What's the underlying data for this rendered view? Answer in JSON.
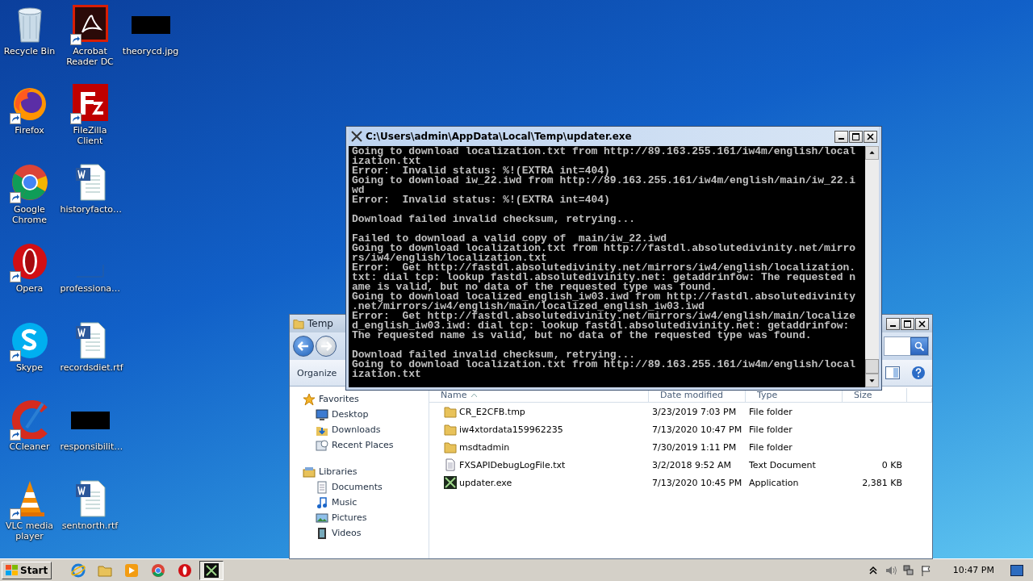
{
  "desktop": {
    "icons": [
      {
        "label": "Recycle Bin",
        "kind": "bin",
        "shortcut": false
      },
      {
        "label": "Firefox",
        "kind": "firefox",
        "shortcut": true
      },
      {
        "label": "Google Chrome",
        "kind": "chrome",
        "shortcut": true
      },
      {
        "label": "Opera",
        "kind": "opera",
        "shortcut": true
      },
      {
        "label": "Skype",
        "kind": "skype",
        "shortcut": true
      },
      {
        "label": "CCleaner",
        "kind": "ccleaner",
        "shortcut": true
      },
      {
        "label": "VLC media player",
        "kind": "vlc",
        "shortcut": true
      },
      {
        "label": "Acrobat Reader DC",
        "kind": "acrobat",
        "shortcut": true
      },
      {
        "label": "FileZilla Client",
        "kind": "filezilla",
        "shortcut": true
      },
      {
        "label": "historyfacto…",
        "kind": "word",
        "shortcut": false
      },
      {
        "label": "professiona…",
        "kind": "blank",
        "shortcut": false
      },
      {
        "label": "recordsdiet.rtf",
        "kind": "word",
        "shortcut": false
      },
      {
        "label": "responsibilit…",
        "kind": "image",
        "shortcut": false
      },
      {
        "label": "sentnorth.rtf",
        "kind": "word",
        "shortcut": false
      },
      {
        "label": "theorycd.jpg",
        "kind": "image",
        "shortcut": false
      }
    ]
  },
  "explorer": {
    "title": "Temp",
    "organize": "Organize",
    "nav": [
      {
        "label": "Favorites",
        "kind": "star",
        "children": [
          {
            "label": "Desktop",
            "kind": "desktop"
          },
          {
            "label": "Downloads",
            "kind": "downloads"
          },
          {
            "label": "Recent Places",
            "kind": "recent"
          }
        ]
      },
      {
        "label": "Libraries",
        "kind": "library",
        "children": [
          {
            "label": "Documents",
            "kind": "documents"
          },
          {
            "label": "Music",
            "kind": "music"
          },
          {
            "label": "Pictures",
            "kind": "pictures"
          },
          {
            "label": "Videos",
            "kind": "videos"
          }
        ]
      }
    ],
    "columns": [
      {
        "label": "Name",
        "sorted": true
      },
      {
        "label": "Date modified",
        "sorted": false
      },
      {
        "label": "Type",
        "sorted": false
      },
      {
        "label": "Size",
        "sorted": false
      }
    ],
    "rows": [
      {
        "name": "CR_E2CFB.tmp",
        "kind": "folder",
        "date": "3/23/2019 7:03 PM",
        "type": "File folder"
      },
      {
        "name": "iw4xtordata159962235",
        "kind": "folder",
        "date": "7/13/2020 10:47 PM",
        "type": "File folder"
      },
      {
        "name": "msdtadmin",
        "kind": "folder",
        "date": "7/30/2019 1:11 PM",
        "type": "File folder"
      },
      {
        "name": "FXSAPIDebugLogFile.txt",
        "kind": "text",
        "date": "3/2/2018 9:52 AM",
        "type": "Text Document",
        "size": "0 KB"
      },
      {
        "name": "updater.exe",
        "kind": "app",
        "date": "7/13/2020 10:45 PM",
        "type": "Application",
        "size": "2,381 KB"
      }
    ]
  },
  "console": {
    "title": "C:\\Users\\admin\\AppData\\Local\\Temp\\updater.exe",
    "blocks": [
      {
        "lines": [
          "Going to download localization.txt from http://89.163.255.161/iw4m/english/local",
          "ization.txt",
          "Error:  Invalid status: %!(EXTRA int=404)",
          "Going to download iw_22.iwd from http://89.163.255.161/iw4m/english/main/iw_22.i",
          "wd",
          "Error:  Invalid status: %!(EXTRA int=404)"
        ]
      },
      {
        "lines": [
          "Download failed invalid checksum, retrying..."
        ]
      },
      {
        "lines": [
          "Failed to download a valid copy of  main/iw_22.iwd",
          "Going to download localization.txt from http://fastdl.absolutedivinity.net/mirro",
          "rs/iw4/english/localization.txt",
          "Error:  Get http://fastdl.absolutedivinity.net/mirrors/iw4/english/localization.",
          "txt: dial tcp: lookup fastdl.absolutedivinity.net: getaddrinfow: The requested n",
          "ame is valid, but no data of the requested type was found.",
          "Going to download localized_english_iw03.iwd from http://fastdl.absolutedivinity",
          ".net/mirrors/iw4/english/main/localized_english_iw03.iwd",
          "Error:  Get http://fastdl.absolutedivinity.net/mirrors/iw4/english/main/localize",
          "d_english_iw03.iwd: dial tcp: lookup fastdl.absolutedivinity.net: getaddrinfow:",
          "The requested name is valid, but no data of the requested type was found."
        ]
      },
      {
        "lines": [
          "Download failed invalid checksum, retrying...",
          "Going to download localization.txt from http://89.163.255.161/iw4m/english/local",
          "ization.txt"
        ]
      }
    ]
  },
  "taskbar": {
    "start": "Start",
    "items": [
      {
        "kind": "ie",
        "selected": false
      },
      {
        "kind": "folder",
        "selected": false
      },
      {
        "kind": "media",
        "selected": false
      },
      {
        "kind": "chrome",
        "selected": false
      },
      {
        "kind": "opera",
        "selected": false
      },
      {
        "kind": "console",
        "selected": true
      }
    ],
    "clock": "10:47 PM"
  }
}
